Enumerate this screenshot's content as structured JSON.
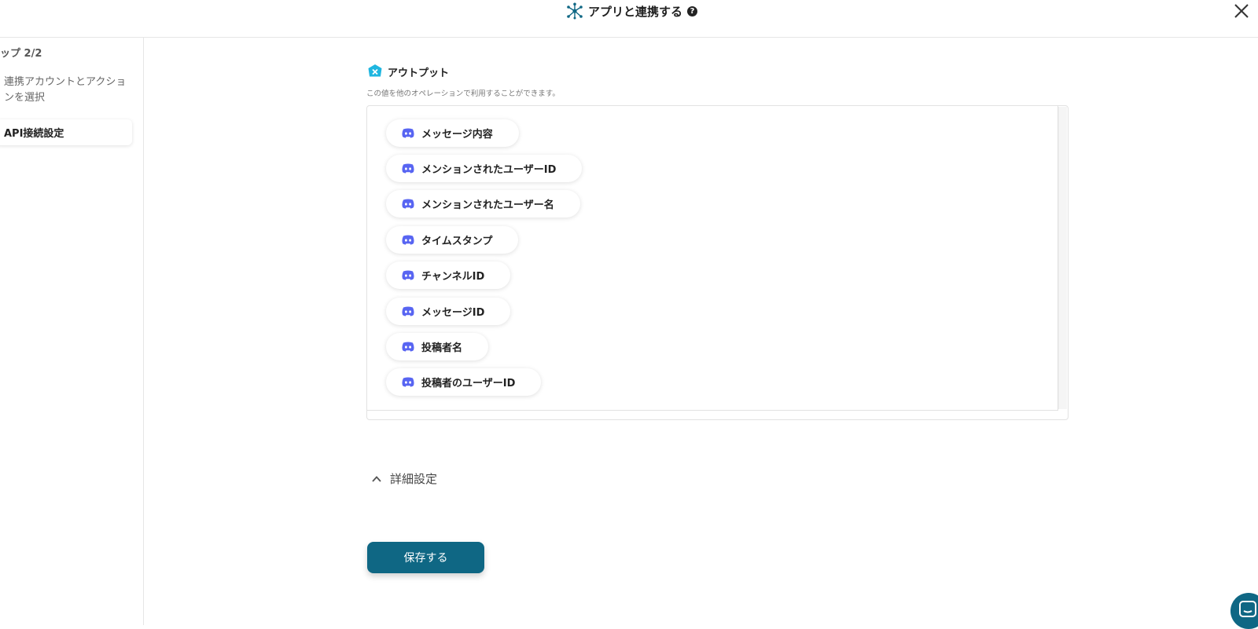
{
  "header": {
    "title": "アプリと連携する",
    "help_icon": "?",
    "icons": {
      "title": "hub-network-icon",
      "help": "question-circle-icon",
      "close": "close-icon"
    }
  },
  "sidebar": {
    "step_label": "ップ 2/2",
    "items": [
      {
        "label": "連携アカウントとアクションを選択",
        "active": false
      },
      {
        "label": "API接続設定",
        "active": true
      }
    ]
  },
  "output": {
    "title": "アウトプット",
    "description": "この値を他のオペレーションで利用することができます。",
    "icon": "output-badge-icon",
    "items": [
      {
        "label": "メッセージ内容",
        "icon": "discord-icon"
      },
      {
        "label": "メンションされたユーザーID",
        "icon": "discord-icon"
      },
      {
        "label": "メンションされたユーザー名",
        "icon": "discord-icon"
      },
      {
        "label": "タイムスタンプ",
        "icon": "discord-icon"
      },
      {
        "label": "チャンネルID",
        "icon": "discord-icon"
      },
      {
        "label": "メッセージID",
        "icon": "discord-icon"
      },
      {
        "label": "投稿者名",
        "icon": "discord-icon"
      },
      {
        "label": "投稿者のユーザーID",
        "icon": "discord-icon"
      }
    ]
  },
  "details": {
    "label": "詳細設定",
    "icon": "chevron-up-icon"
  },
  "save_button": {
    "label": "保存する"
  },
  "chat": {
    "icon": "chat-icon"
  },
  "colors": {
    "primary": "#0f6784",
    "discord": "#5865f2",
    "output_badge": "#1fb6e0"
  }
}
